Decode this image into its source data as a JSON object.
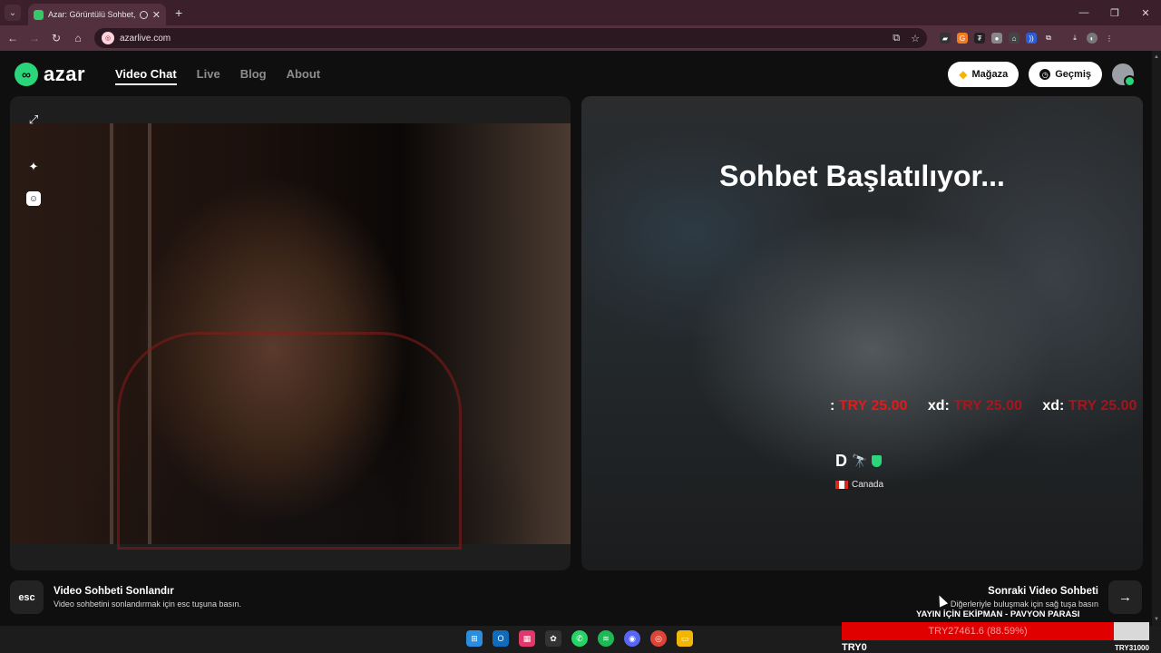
{
  "browser": {
    "tab_title": "Azar: Görüntülü Sohbet, Ar",
    "url": "azarlive.com",
    "window_controls": [
      "minimize-icon",
      "restore-icon",
      "close-icon"
    ]
  },
  "site": {
    "brand": "azar",
    "nav": [
      {
        "label": "Video Chat",
        "active": true
      },
      {
        "label": "Live",
        "active": false
      },
      {
        "label": "Blog",
        "active": false
      },
      {
        "label": "About",
        "active": false
      }
    ],
    "store_label": "Mağaza",
    "history_label": "Geçmiş",
    "accent_color": "#2bd67b"
  },
  "chat": {
    "status_title": "Sohbet Başlatılıyor...",
    "peer_name": "D",
    "peer_country": "Canada",
    "donation_ticker": [
      {
        "key": ":",
        "value": "TRY 25.00"
      },
      {
        "key": "xd:",
        "value": "TRY 25.00"
      },
      {
        "key": "xd:",
        "value": "TRY 25.00"
      }
    ],
    "donation_color": "#e11a1a"
  },
  "actions": {
    "esc_key": "esc",
    "end_title": "Video Sohbeti Sonlandır",
    "end_sub": "Video sohbetini sonlandırmak için esc tuşuna basın.",
    "next_title": "Sonraki Video Sohbeti",
    "next_sub": "Diğerleriyle buluşmak için sağ tuşa basın"
  },
  "stream_overlay": {
    "goal_title": "YAYIN İÇİN EKİPMAN - PAVYON PARASI",
    "goal_text": "TRY27461.6 (88.59%)",
    "goal_progress_percent": 88.59,
    "goal_min": "TRY0",
    "goal_max": "TRY31000"
  },
  "taskbar": {
    "icons": [
      "windows-start-icon",
      "outlook-icon",
      "app-icon",
      "chatgpt-icon",
      "whatsapp-icon",
      "spotify-icon",
      "discord-icon",
      "chrome-icon",
      "file-explorer-icon"
    ]
  }
}
